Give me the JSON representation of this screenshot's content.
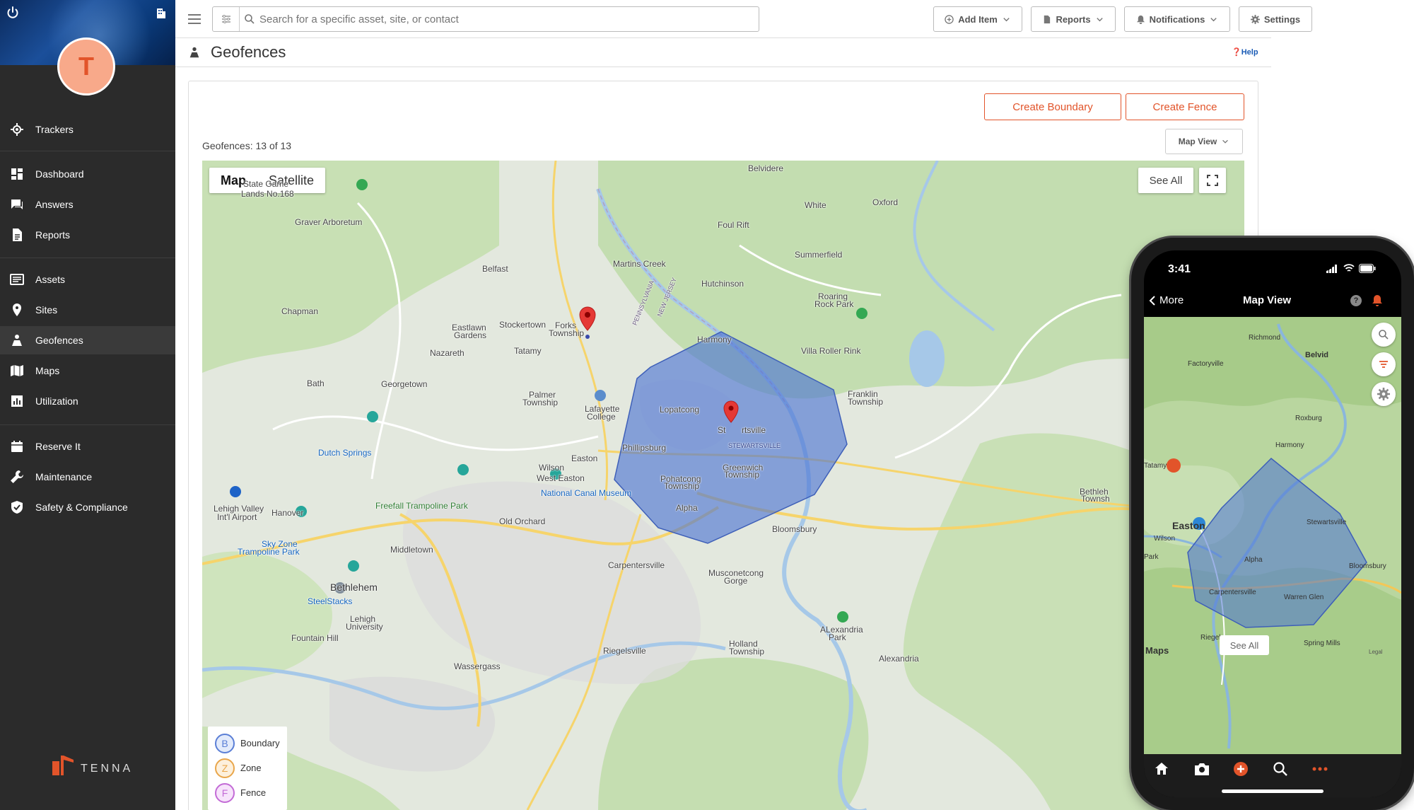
{
  "topbar": {
    "search_placeholder": "Search for a specific asset, site, or contact",
    "add_item": "Add Item",
    "reports": "Reports",
    "notifications": "Notifications",
    "settings": "Settings"
  },
  "sidebar": {
    "avatar_letter": "T",
    "items": [
      {
        "label": "Trackers",
        "icon": "tracker-icon"
      },
      {
        "label": "Dashboard",
        "icon": "dashboard-icon"
      },
      {
        "label": "Answers",
        "icon": "answers-icon"
      },
      {
        "label": "Reports",
        "icon": "reports-icon"
      },
      {
        "label": "Assets",
        "icon": "assets-icon"
      },
      {
        "label": "Sites",
        "icon": "location-pin-icon"
      },
      {
        "label": "Geofences",
        "icon": "geofence-icon",
        "active": true
      },
      {
        "label": "Maps",
        "icon": "map-icon"
      },
      {
        "label": "Utilization",
        "icon": "utilization-icon"
      },
      {
        "label": "Reserve It",
        "icon": "calendar-icon"
      },
      {
        "label": "Maintenance",
        "icon": "wrench-icon"
      },
      {
        "label": "Safety & Compliance",
        "icon": "shield-icon"
      }
    ],
    "logo_text": "TENNA"
  },
  "page": {
    "title": "Geofences",
    "help": "Help",
    "create_boundary": "Create Boundary",
    "create_fence": "Create Fence",
    "count": "Geofences: 13 of 13",
    "view_select": "Map View"
  },
  "map": {
    "type_map": "Map",
    "type_satellite": "Satellite",
    "see_all": "See All",
    "legend": [
      {
        "letter": "B",
        "label": "Boundary",
        "color": "#5b7fd6",
        "bg": "#e3ebfb"
      },
      {
        "letter": "Z",
        "label": "Zone",
        "color": "#e9a64b",
        "bg": "#fdf0dc"
      },
      {
        "letter": "F",
        "label": "Fence",
        "color": "#c36bd6",
        "bg": "#f7e3fb"
      }
    ],
    "labels": {
      "belvidere": "Belvidere",
      "white": "White",
      "oxford": "Oxford",
      "state_game": "State Game",
      "lands": "Lands No.168",
      "graver": "Graver Arboretum",
      "foul_rift": "Foul Rift",
      "summerfield": "Summerfield",
      "martins_creek": "Martins Creek",
      "hutchinson": "Hutchinson",
      "belfast": "Belfast",
      "roaring": "Roaring",
      "rock_park": "Rock Park",
      "chapman": "Chapman",
      "eastlawn": "Eastlawn",
      "gardens": "Gardens",
      "stockertown": "Stockertown",
      "forks": "Forks",
      "township": "Township",
      "harmony": "Harmony",
      "villa_roller": "Villa Roller Rink",
      "nazareth": "Nazareth",
      "tatamy": "Tatamy",
      "bath": "Bath",
      "georgetown": "Georgetown",
      "franklin": "Franklin",
      "franklin_twp": "Township",
      "palmer": "Palmer",
      "palmer_twp": "Township",
      "lopatcong": "Lopatcong",
      "lafayette": "Lafayette",
      "college": "College",
      "stewartsville_a": "St",
      "stewartsville_b": "rtsville",
      "stewartsville_c": "STEWARTSVILLE",
      "phillipsburg": "Phillipsburg",
      "easton": "Easton",
      "dutch_springs": "Dutch Springs",
      "wilson": "Wilson",
      "west_easton": "West Easton",
      "greenwich": "Greenwich",
      "greenwich_twp": "Township",
      "pohatcong": "Pohatcong",
      "pohatcong_twp": "Township",
      "canal_museum": "National Canal Museum",
      "bethlehem_r": "Bethleh",
      "bethlehem_r2": "Townsh",
      "lehigh_valley": "Lehigh Valley",
      "intl_airport": "Int'l Airport",
      "hanover": "Hanover",
      "freefall": "Freefall Trampoline Park",
      "alpha": "Alpha",
      "old_orchard": "Old Orchard",
      "bloomsbury": "Bloomsbury",
      "sky_zone": "Sky Zone",
      "trampoline_park": "Trampoline Park",
      "middletown": "Middletown",
      "carpentersville": "Carpentersville",
      "musconetcong": "Musconetcong",
      "gorge": "Gorge",
      "bethlehem": "Bethlehem",
      "steelstacks": "SteelStacks",
      "lehigh_univ": "Lehigh",
      "university": "University",
      "fountain_hill": "Fountain Hill",
      "riegelsville": "Riegelsville",
      "holland": "Holland",
      "holland_twp": "Township",
      "alexandria_park": "ALexandria",
      "park": "Park",
      "alexandria": "Alexandria",
      "wassergass": "Wassergass",
      "pennsylvania": "PENNSYLVANIA",
      "new_jersey": "NEW JERSEY"
    }
  },
  "phone": {
    "time": "3:41",
    "back": "More",
    "title": "Map View",
    "see_all": "See All",
    "maps_brand": "Maps",
    "labels": {
      "richmond": "Richmond",
      "belvid": "Belvid",
      "factoryville": "Factoryville",
      "roxburg": "Roxburg",
      "harmony": "Harmony",
      "tatamy": "Tatamy",
      "easton": "Easton",
      "wilson": "Wilson",
      "stewartsville": "Stewartsville",
      "alpha": "Alpha",
      "bloomsbury": "Bloomsbury",
      "carpentersville": "Carpentersville",
      "warren_glen": "Warren Glen",
      "riegel": "Riegel",
      "spring_mills": "Spring Mills",
      "park": "Park",
      "legal": "Legal"
    }
  }
}
